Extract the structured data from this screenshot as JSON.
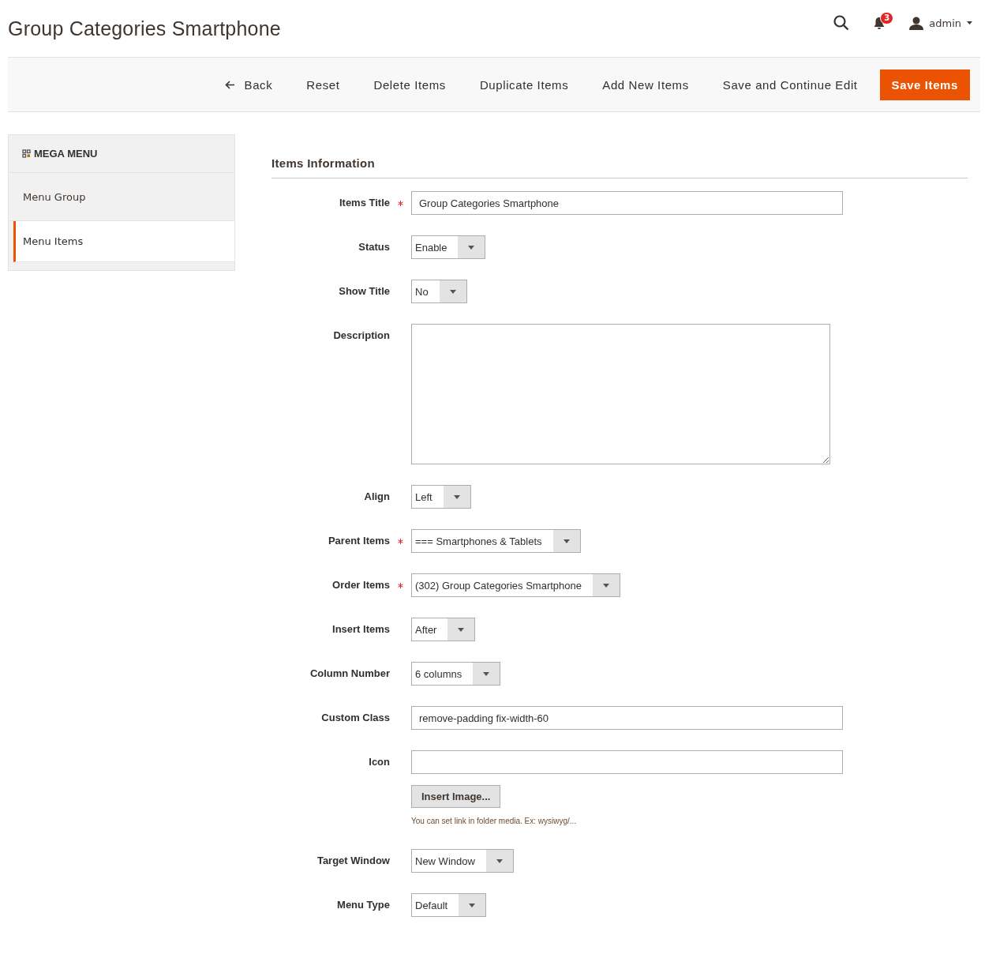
{
  "page_title": "Group Categories Smartphone",
  "header": {
    "notification_count": "3",
    "user": "admin"
  },
  "toolbar": {
    "buttons": [
      {
        "label": "Back",
        "kind": "back"
      },
      {
        "label": "Reset",
        "kind": "plain"
      },
      {
        "label": "Delete Items",
        "kind": "plain"
      },
      {
        "label": "Duplicate Items",
        "kind": "plain"
      },
      {
        "label": "Add New Items",
        "kind": "plain"
      },
      {
        "label": "Save and Continue Edit",
        "kind": "plain"
      },
      {
        "label": "Save Items",
        "kind": "primary"
      }
    ]
  },
  "sidebar": {
    "title": "MEGA MENU",
    "items": [
      {
        "label": "Menu Group",
        "selected": false
      },
      {
        "label": "Menu Items",
        "selected": true
      }
    ]
  },
  "section_title": "Items Information",
  "fields": [
    {
      "label": "Items Title",
      "kind": "text",
      "required": true,
      "value": "Group Categories Smartphone"
    },
    {
      "label": "Status",
      "kind": "select",
      "required": false,
      "value": "Enable"
    },
    {
      "label": "Show Title",
      "kind": "select",
      "required": false,
      "value": "No"
    },
    {
      "label": "Description",
      "kind": "textarea",
      "required": false
    },
    {
      "label": "Align",
      "kind": "select",
      "required": false,
      "value": "Left"
    },
    {
      "label": "Parent Items",
      "kind": "select",
      "required": true,
      "value": "=== Smartphones & Tablets"
    },
    {
      "label": "Order Items",
      "kind": "select",
      "required": true,
      "value": "(302) Group Categories Smartphone"
    },
    {
      "label": "Insert Items",
      "kind": "select",
      "required": false,
      "value": "After"
    },
    {
      "label": "Column Number",
      "kind": "select",
      "required": false,
      "value": "6 columns"
    },
    {
      "label": "Custom Class",
      "kind": "text",
      "required": false,
      "value": "remove-padding fix-width-60"
    },
    {
      "label": "Icon",
      "kind": "image",
      "required": false,
      "button": "Insert Image...",
      "note": "You can set link in folder media. Ex: wysiwyg/..."
    },
    {
      "label": "Target Window",
      "kind": "select",
      "required": false,
      "value": "New Window"
    },
    {
      "label": "Menu Type",
      "kind": "select",
      "required": false,
      "value": "Default"
    }
  ]
}
